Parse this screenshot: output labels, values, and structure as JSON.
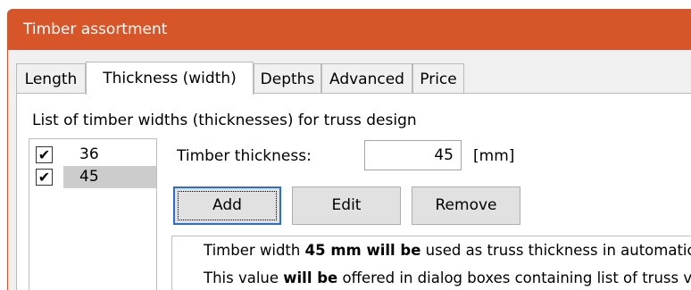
{
  "window": {
    "title": "Timber assortment"
  },
  "tabs": [
    {
      "label": "Length",
      "active": false
    },
    {
      "label": "Thickness (width)",
      "active": true
    },
    {
      "label": "Depths",
      "active": false
    },
    {
      "label": "Advanced",
      "active": false
    },
    {
      "label": "Price",
      "active": false
    }
  ],
  "list": {
    "label": "List of timber widths (thicknesses) for truss design",
    "items": [
      {
        "value": "36",
        "checked": true,
        "selected": false
      },
      {
        "value": "45",
        "checked": true,
        "selected": true
      }
    ],
    "check_glyph": "✔"
  },
  "form": {
    "thickness_label": "Timber thickness:",
    "thickness_value": "45",
    "unit": "[mm]"
  },
  "buttons": {
    "add": "Add",
    "edit": "Edit",
    "remove": "Remove"
  },
  "info": {
    "line1": {
      "t1": "Timber width ",
      "b1": "45 mm will be",
      "t2": " used as truss thickness in automatic"
    },
    "line2": {
      "t1": "This value ",
      "b1": "will be",
      "t2": " offered in dialog boxes containing list of truss v"
    }
  },
  "colors": {
    "titlebar": "#d6562a",
    "selection": "#cccccc",
    "default_button_border": "#2b6fce"
  }
}
